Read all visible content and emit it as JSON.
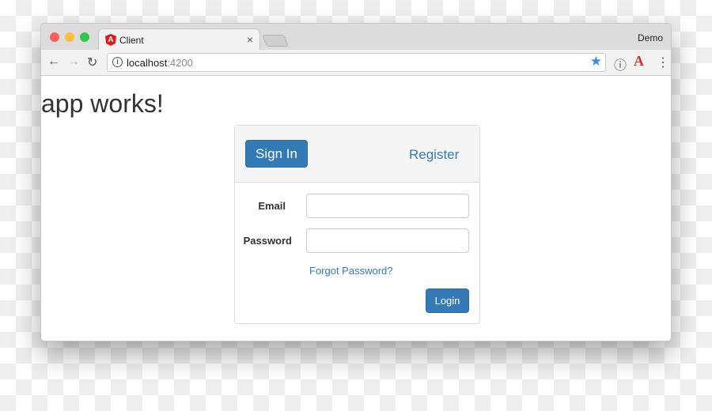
{
  "browser": {
    "tab_title": "Client",
    "profile": "Demo",
    "url_host": "localhost",
    "url_port": ":4200",
    "colors": {
      "accent": "#337ab7",
      "close": "#fc605b",
      "min": "#fdbc40",
      "max": "#34c84a"
    }
  },
  "page": {
    "heading": "app works!"
  },
  "card": {
    "signin_label": "Sign In",
    "register_label": "Register",
    "email_label": "Email",
    "email_value": "",
    "password_label": "Password",
    "password_value": "",
    "forgot_label": "Forgot Password?",
    "login_label": "Login"
  }
}
